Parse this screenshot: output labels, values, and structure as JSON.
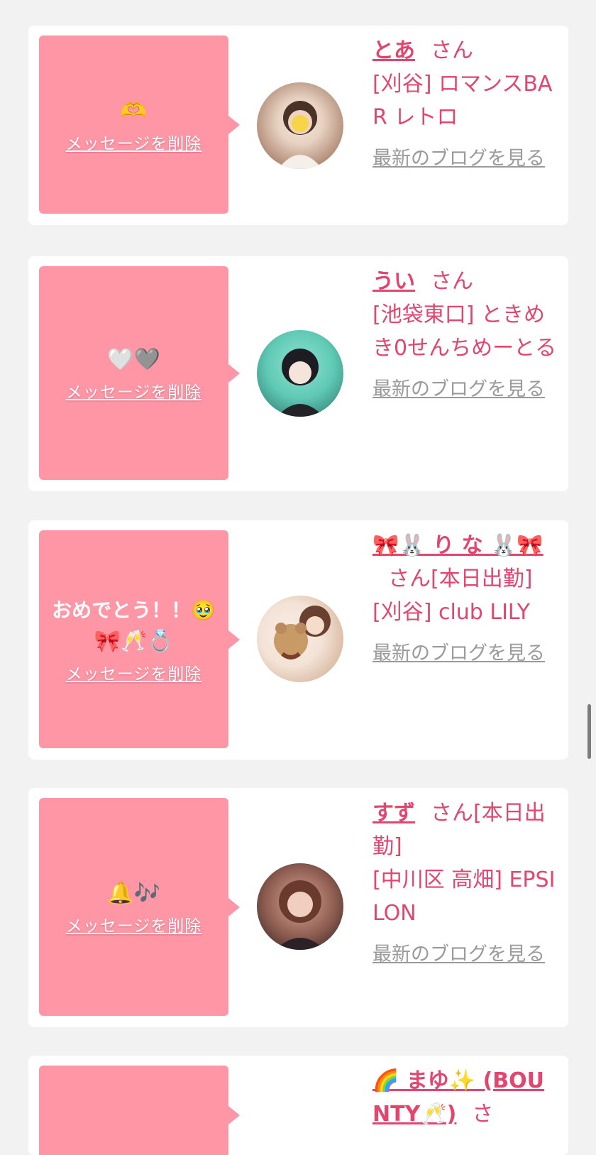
{
  "cards": [
    {
      "message": "",
      "emoji": "🫶",
      "delete_label": "メッセージを削除",
      "name": "とあ",
      "san": "さん",
      "status": "",
      "shop": "[刈谷] ロマンスBAR レトロ",
      "blog_label": "最新のブログを見る",
      "avatar_colors": [
        "#e8d2c2",
        "#8a5a42"
      ]
    },
    {
      "message": "",
      "emoji": "🤍🩶",
      "delete_label": "メッセージを削除",
      "name": "うい",
      "san": "さん",
      "status": "",
      "shop": "[池袋東口] ときめき0せんちめーとる",
      "blog_label": "最新のブログを見る",
      "avatar_colors": [
        "#5fc9b4",
        "#1f3b3a"
      ]
    },
    {
      "message": "おめでとう！！🥹",
      "emoji": "🎀🥂💍",
      "delete_label": "メッセージを削除",
      "name": "🎀🐰 り な 🐰🎀",
      "san": "さん",
      "status": "[本日出勤]",
      "shop": "[刈谷] club LILY",
      "blog_label": "最新のブログを見る",
      "avatar_colors": [
        "#f3e2d6",
        "#b98a5e"
      ]
    },
    {
      "message": "",
      "emoji": "🔔🎶",
      "delete_label": "メッセージを削除",
      "name": "すず",
      "san": "さん",
      "status": "[本日出勤]",
      "shop": "[中川区 高畑] EPSILON",
      "blog_label": "最新のブログを見る",
      "avatar_colors": [
        "#c58f7d",
        "#2a1e22"
      ]
    },
    {
      "message": "",
      "emoji": "",
      "delete_label": "",
      "name": "🌈 まゆ✨ (BOUNTY🥂)",
      "san": "さ",
      "status": "",
      "shop": "",
      "blog_label": "",
      "avatar_colors": [
        "#ffffff",
        "#ffffff"
      ]
    }
  ],
  "colors": {
    "page_bg": "#f2f2f2",
    "card_bg": "#ffffff",
    "message_bg": "#ff96a6",
    "accent": "#e2456e",
    "link_gray": "#9a9a9a"
  }
}
